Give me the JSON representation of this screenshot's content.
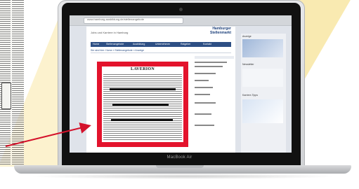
{
  "laptop": {
    "model_label": "MacBook Air"
  },
  "browser": {
    "url": "www.hamburg-ausbildung.de/stellenangebote"
  },
  "website": {
    "tagline": "Jobs und Karriere in Hamburg",
    "logo_line1": "Hamburger",
    "logo_line2": "Stellenmarkt",
    "nav_items": [
      "Home",
      "Stellenangebote",
      "Ausbildung",
      "Unternehmen",
      "Ratgeber",
      "Kontakt"
    ],
    "subline": "Sie sind hier: Home » Stellenangebote » Anzeige",
    "right_titles": [
      "Anzeige",
      "Newsletter",
      "Karriere-Tipps"
    ]
  },
  "ad": {
    "title": "LAVERION"
  },
  "colors": {
    "highlight": "#e3132c",
    "arrow": "#d4122b",
    "nav": "#2d4f84",
    "accent_yellow": "#f8e8a8"
  }
}
